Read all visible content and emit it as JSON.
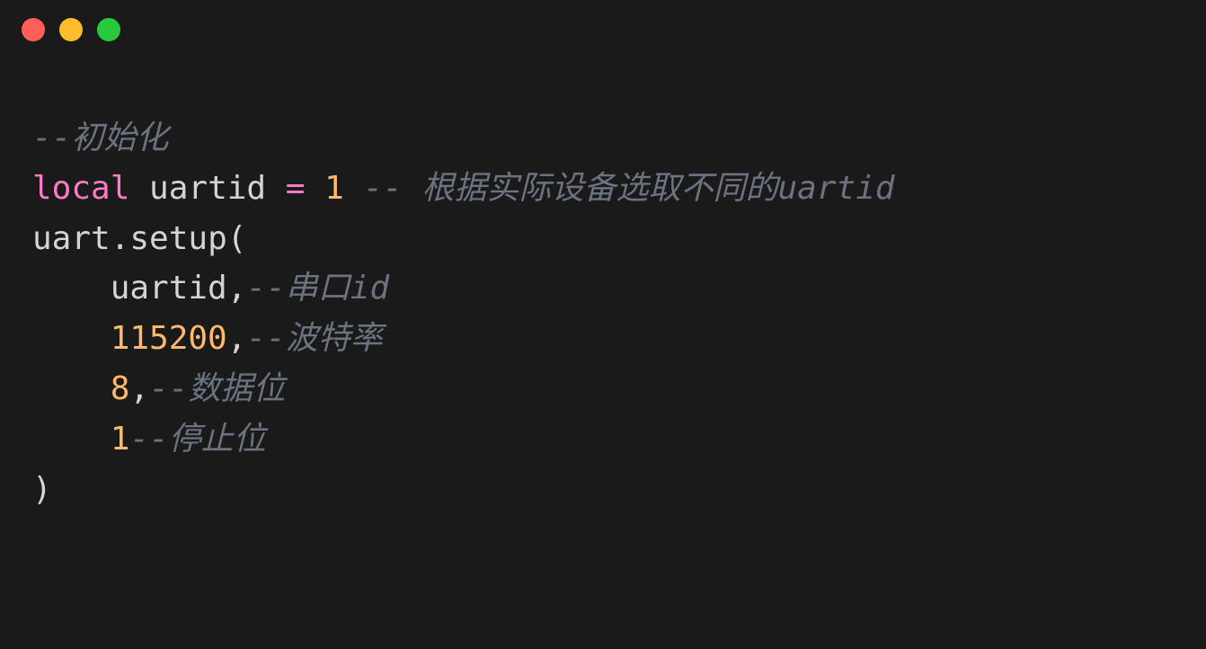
{
  "code": {
    "line1": {
      "comment": "--初始化"
    },
    "line2": {
      "keyword": "local",
      "identifier": " uartid ",
      "operator": "=",
      "number": " 1 ",
      "comment": "-- 根据实际设备选取不同的uartid"
    },
    "line3": {
      "text": "uart.setup("
    },
    "line4": {
      "identifier": "uartid",
      "punct": ",",
      "comment": "--串口id"
    },
    "line5": {
      "number": "115200",
      "punct": ",",
      "comment": "--波特率"
    },
    "line6": {
      "number": "8",
      "punct": ",",
      "comment": "--数据位"
    },
    "line7": {
      "number": "1",
      "comment": "--停止位"
    },
    "line8": {
      "text": ")"
    }
  }
}
